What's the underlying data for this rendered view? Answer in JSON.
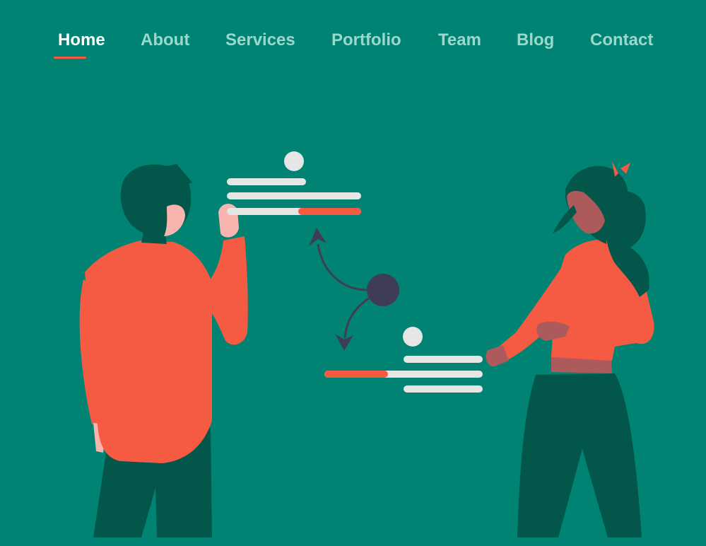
{
  "nav": {
    "items": [
      {
        "label": "Home",
        "active": true
      },
      {
        "label": "About",
        "active": false
      },
      {
        "label": "Services",
        "active": false
      },
      {
        "label": "Portfolio",
        "active": false
      },
      {
        "label": "Team",
        "active": false
      },
      {
        "label": "Blog",
        "active": false
      },
      {
        "label": "Contact",
        "active": false
      }
    ]
  },
  "colors": {
    "background": "#018374",
    "accent": "#f45b42",
    "nav_inactive": "#9bd8cc",
    "nav_active": "#ffffff",
    "dark_green": "#02574a",
    "node": "#3f3d56",
    "card_lines": "#e6e6e6"
  },
  "illustration": {
    "name": "two-people-exchanging-data",
    "cards": [
      {
        "name": "top-card",
        "progress": 0.47
      },
      {
        "name": "bottom-card",
        "progress": 0.4
      }
    ]
  }
}
